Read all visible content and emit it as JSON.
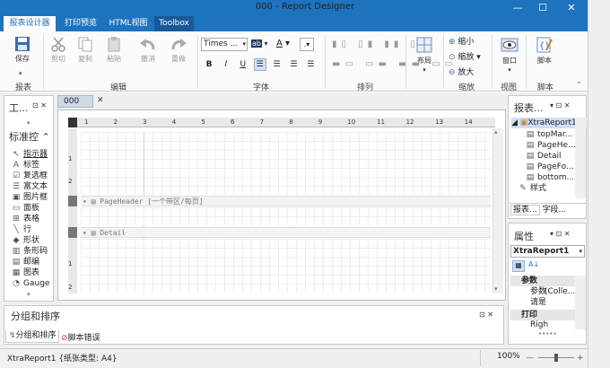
{
  "window": {
    "title": "000 - Report Designer",
    "minimize": "—",
    "maximize": "☐",
    "close": "✕"
  },
  "tabs": [
    "报表设计器",
    "打印预览",
    "HTML视图",
    "Toolbox"
  ],
  "ribbon": {
    "groups": [
      "报表",
      "编辑",
      "字体",
      "排列",
      "缩放",
      "视图",
      "脚本"
    ],
    "save": "保存",
    "cut": "剪切",
    "copy": "复制",
    "paste": "粘贴",
    "undo": "撤消",
    "redo": "重做",
    "font_name": "Times ...",
    "zoom_in": "缩小",
    "zoom": "缩放",
    "zoom_out": "放大",
    "layout": "布局",
    "window": "窗口",
    "script": "脚本",
    "bold": "B",
    "italic": "I",
    "underline": "U"
  },
  "toolbox": {
    "title": "工...",
    "section": "标准控",
    "items": [
      {
        "icon": "pointer-icon",
        "glyph": "↖",
        "label": "指示器"
      },
      {
        "icon": "label-icon",
        "glyph": "A",
        "label": "标签"
      },
      {
        "icon": "checkbox-icon",
        "glyph": "☑",
        "label": "复选框"
      },
      {
        "icon": "richtext-icon",
        "glyph": "☰",
        "label": "富文本"
      },
      {
        "icon": "picture-icon",
        "glyph": "▣",
        "label": "图片框"
      },
      {
        "icon": "panel-icon",
        "glyph": "▭",
        "label": "面板"
      },
      {
        "icon": "table-icon",
        "glyph": "⊞",
        "label": "表格"
      },
      {
        "icon": "line-icon",
        "glyph": "╲",
        "label": "行"
      },
      {
        "icon": "shape-icon",
        "glyph": "◆",
        "label": "形状"
      },
      {
        "icon": "barcode-icon",
        "glyph": "▥",
        "label": "条形码"
      },
      {
        "icon": "zipcode-icon",
        "glyph": "▤",
        "label": "邮编"
      },
      {
        "icon": "chart-icon",
        "glyph": "▦",
        "label": "图表"
      },
      {
        "icon": "gauge-icon",
        "glyph": "◔",
        "label": "Gauge"
      }
    ]
  },
  "document_tab": "000",
  "designer": {
    "ruler": [
      "1",
      "2",
      "3",
      "4",
      "5",
      "6",
      "7",
      "8",
      "9",
      "10",
      "11",
      "12",
      "13",
      "14"
    ],
    "page_header_band": "PageHeader [一个带区/每页]",
    "detail_band": "Detail",
    "vruler_top": [
      "1",
      "2"
    ],
    "vruler_bottom": [
      "1",
      "2"
    ]
  },
  "group_panel": {
    "title": "分组和排序",
    "tab_group": "分组和排序",
    "tab_script": "脚本错误"
  },
  "explorer": {
    "title": "报表...",
    "root": "XtraReport1",
    "items": [
      "topMar...",
      "PageHe...",
      "Detail",
      "PageFo...",
      "bottom...",
      "样式"
    ],
    "tab1": "报表...",
    "tab2": "字段..."
  },
  "properties": {
    "title": "属性",
    "selected": "XtraReport1",
    "cat_params": "参数",
    "row1_name": "参数",
    "row1_value": "(Colle...",
    "row2_name": "请是",
    "cat_print": "打印",
    "row3_name": "Righ"
  },
  "status": {
    "text": "XtraReport1 {纸张类型: A4}",
    "zoom": "100%",
    "zoom_minus": "—",
    "zoom_plus": "+"
  },
  "colors": {
    "accent": "#1e73be"
  }
}
